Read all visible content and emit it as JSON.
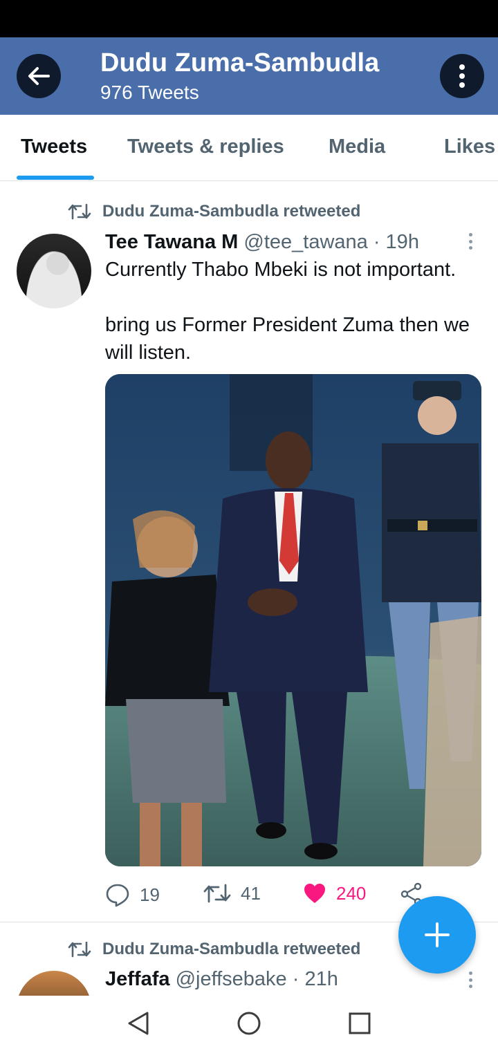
{
  "header": {
    "title": "Dudu Zuma-Sambudla",
    "subtitle": "976 Tweets",
    "back_icon": "arrow-left-icon",
    "more_icon": "more-vertical-icon",
    "color": "#4a6ea9"
  },
  "tabs": [
    {
      "label": "Tweets",
      "active": true
    },
    {
      "label": "Tweets & replies",
      "active": false
    },
    {
      "label": "Media",
      "active": false
    },
    {
      "label": "Likes",
      "active": false
    }
  ],
  "tweets": [
    {
      "retweet_label": "Dudu Zuma-Sambudla retweeted",
      "name": "Tee Tawana M",
      "handle": "@tee_tawana",
      "time": "· 19h",
      "text_lines": [
        "Currently Thabo Mbeki is not important.",
        "bring us Former President Zuma then we",
        "will listen."
      ],
      "stats": {
        "replies": "19",
        "retweets": "41",
        "likes": "240"
      }
    },
    {
      "retweet_label": "Dudu Zuma-Sambudla retweeted",
      "name": "Jeffafa",
      "handle": "@jeffsebake",
      "time": "· 21h"
    }
  ],
  "fab": {
    "icon": "plus-icon",
    "color": "#1d9bf0"
  },
  "accent_color": "#1d9bf0",
  "like_color": "#f91880"
}
